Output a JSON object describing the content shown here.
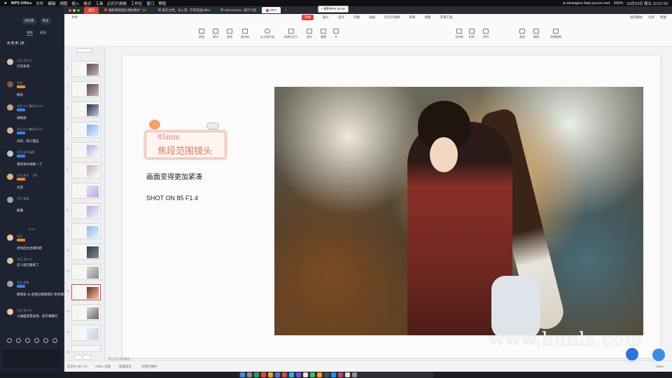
{
  "menubar": {
    "app_name": "WPS Office",
    "items": [
      "文件",
      "编辑",
      "视图",
      "插入",
      "格式",
      "工具",
      "幻灯片放映",
      "工作区",
      "窗口",
      "帮助"
    ],
    "right_text": "w strangers that you've met",
    "clock": "10月22日 周五 22:57:20",
    "battery": "100%"
  },
  "chat": {
    "buttons": [
      "资料库",
      "更多"
    ],
    "tabs": [
      "讨论",
      "成员"
    ],
    "users_line": "共 善 用【条",
    "time_divider": "22:30",
    "messages": [
      {
        "name": "学员-用户名",
        "text": "只有表演",
        "badge": "none"
      },
      {
        "name": "学员",
        "text": "明白",
        "badge": "orange"
      },
      {
        "name": "学员-875-整网页-802",
        "text": "清晰感",
        "badge": "blue"
      },
      {
        "name": "学员-875-整网页-802",
        "text": "对的，抓三需这",
        "badge": "blue"
      },
      {
        "name": "学员-新手摄影",
        "text": "请老师也讲解一下",
        "badge": "blue"
      },
      {
        "name": "学员-新手 · 了解",
        "text": "文案",
        "badge": "orange"
      },
      {
        "name": "学员-高级",
        "text": "能摄",
        "badge": "none"
      },
      {
        "name": "学员",
        "text": "老师后台也要的吧",
        "badge": "orange"
      },
      {
        "name": "学员-用户名",
        "text": "走人就在看来了",
        "badge": "none"
      },
      {
        "name": "学员-高级",
        "text": "那我会 ok 后我记来教我们 更多我教程",
        "badge": "blue"
      },
      {
        "name": "学员-用户名",
        "text": "小曲面是客进来，就子哪都行",
        "badge": "none"
      }
    ]
  },
  "wps": {
    "recording_label": "• 录制中02:30:30",
    "tabs": [
      {
        "label": "首页",
        "type": "home"
      },
      {
        "label": "摄影教程理论课程素材（2）",
        "type": "normal"
      },
      {
        "label": "晨云文档，未入第...学的花园Office",
        "type": "normal"
      },
      {
        "label": "8/51421109...提示卡是",
        "type": "normal"
      },
      {
        "label": "PPT",
        "type": "sel"
      }
    ],
    "ribbon_tabs": [
      "开始",
      "插入",
      "设计",
      "切换",
      "动画",
      "幻灯片放映",
      "审阅",
      "视图",
      "开发工具"
    ],
    "active_ribbon_tab": "开始",
    "file_label": "文件",
    "ribbon_right": [
      "协作模式",
      "分享",
      "帮助"
    ],
    "ribbon_groups": [
      "粘贴",
      "剪切",
      "复制",
      "格式刷",
      "从当前开始",
      "新建幻灯片",
      "版式",
      "重置",
      "节",
      "文本框",
      "形状",
      "排列",
      "查找",
      "替换",
      "选择窗格"
    ],
    "thumbs_header": "",
    "thumbnails": 15,
    "active_thumb": 11,
    "slide": {
      "tag_en": "85mm",
      "tag_cn": "焦段范围镜头",
      "line1": "画面变得更加紧凑",
      "line2": "SHOT ON 85 F1.4"
    },
    "notes_placeholder": "单击此处添加备注",
    "status": {
      "slide_counter": "幻灯片 68 / 79",
      "theme": "Office 主题",
      "smart": "智能美化",
      "protect": "文档已保护",
      "zoom": "113%"
    }
  },
  "watermark": "www.hunls.com",
  "float_button_label": "1人举手"
}
